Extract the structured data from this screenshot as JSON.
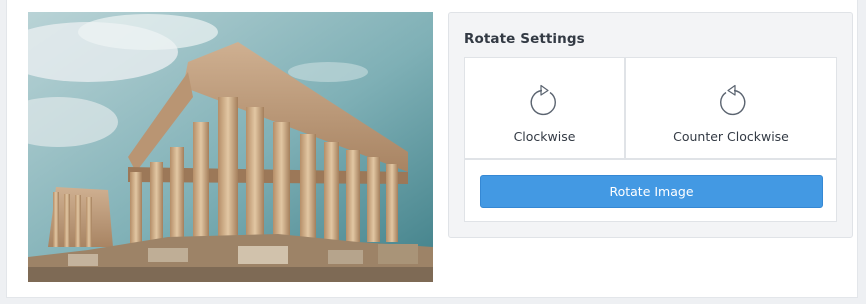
{
  "image": {
    "alt_icon": "parthenon-photo",
    "sky_color_top": "#4f8b95",
    "sky_color_bottom": "#a9c9cf",
    "stone_color": "#c9a27a"
  },
  "settings": {
    "title": "Rotate Settings",
    "options": [
      {
        "label": "Clockwise",
        "icon": "rotate-clockwise-icon"
      },
      {
        "label": "Counter Clockwise",
        "icon": "rotate-counter-clockwise-icon"
      }
    ],
    "action_label": "Rotate Image",
    "accent_color": "#4399e3"
  }
}
